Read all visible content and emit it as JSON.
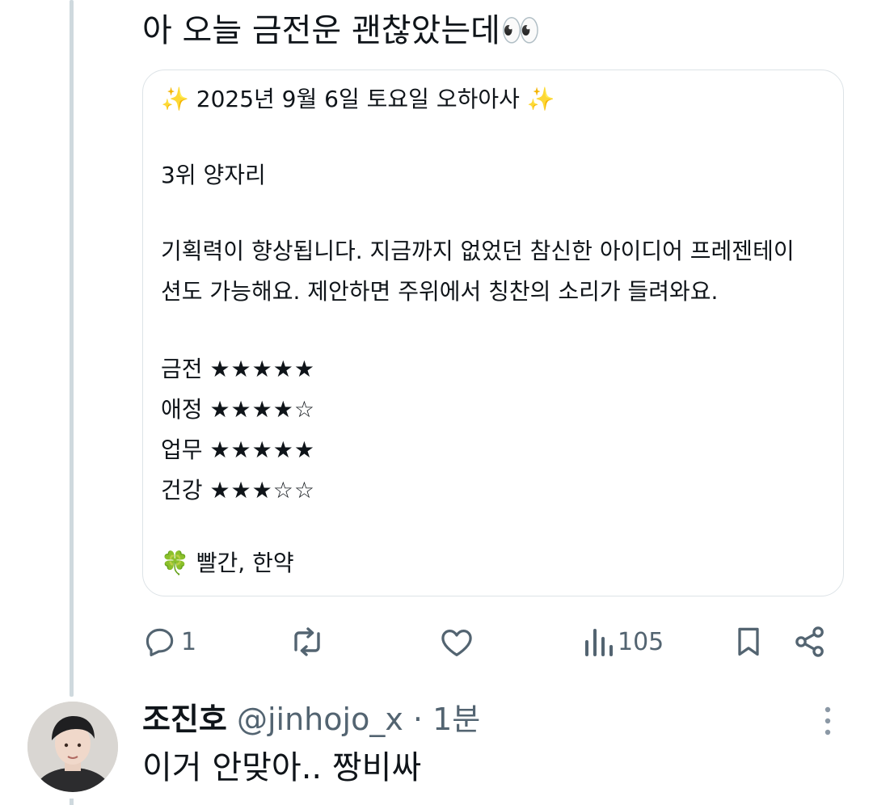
{
  "post": {
    "text": "아 오늘 금전운 괜찮았는데👀",
    "card": {
      "title": "✨ 2025년 9월 6일 토요일 오하아사 ✨",
      "rank": "3위 양자리",
      "desc_line1": "기획력이 향상됩니다. 지금까지 없었던 참신한 아이디어 프레젠테이",
      "desc_line2": "션도 가능해요. 제안하면 주위에서 칭찬의 소리가 들려와요.",
      "ratings": [
        {
          "label": "금전",
          "stars": "★★★★★",
          "value": 5
        },
        {
          "label": "애정",
          "stars": "★★★★☆",
          "value": 4
        },
        {
          "label": "업무",
          "stars": "★★★★★",
          "value": 5
        },
        {
          "label": "건강",
          "stars": "★★★☆☆",
          "value": 3
        }
      ],
      "lucky": "🍀 빨간, 한약"
    },
    "actions": {
      "reply_count": "1",
      "repost_count": "",
      "like_count": "",
      "views_count": "105"
    }
  },
  "reply": {
    "display_name": "조진호",
    "handle": "@jinhojo_x",
    "separator": "·",
    "time": "1분",
    "text": "이거 안맞아.. 짱비싸"
  },
  "colors": {
    "text": "#0f1419",
    "secondary": "#536471",
    "border": "#dde3e7",
    "thread_line": "#cfd9de"
  }
}
